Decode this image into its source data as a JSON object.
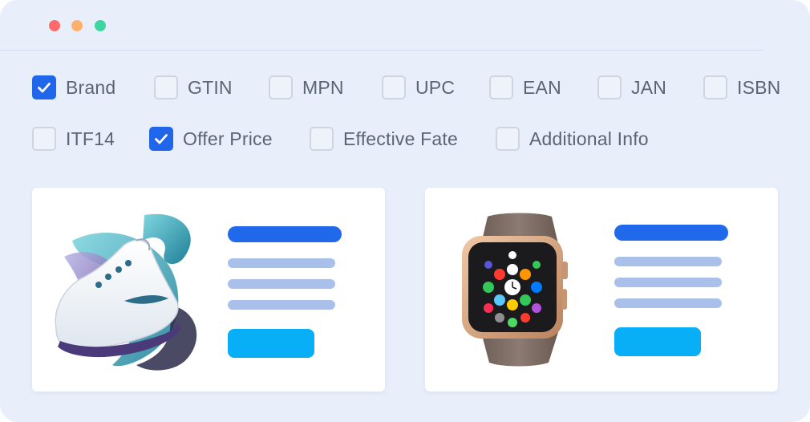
{
  "window": {
    "controls": [
      {
        "name": "close",
        "color": "#ff6b6b"
      },
      {
        "name": "minimize",
        "color": "#ffb06b"
      },
      {
        "name": "maximize",
        "color": "#3ed6a0"
      }
    ]
  },
  "filters": {
    "row1": [
      {
        "label": "Brand",
        "checked": true
      },
      {
        "label": "GTIN",
        "checked": false
      },
      {
        "label": "MPN",
        "checked": false
      },
      {
        "label": "UPC",
        "checked": false
      },
      {
        "label": "EAN",
        "checked": false
      },
      {
        "label": "JAN",
        "checked": false
      },
      {
        "label": "ISBN",
        "checked": false
      }
    ],
    "row2": [
      {
        "label": "ITF14",
        "checked": false
      },
      {
        "label": "Offer Price",
        "checked": true
      },
      {
        "label": "Effective Fate",
        "checked": false
      },
      {
        "label": "Additional Info",
        "checked": false
      }
    ]
  },
  "products": [
    {
      "image": "sneaker-image"
    },
    {
      "image": "smartwatch-image"
    }
  ],
  "colors": {
    "accent": "#1f66ea",
    "title_bar": "#2069ea",
    "text_line": "#a9c1ea",
    "button": "#08aef6",
    "background": "#e8effb",
    "label_text": "#5b6472"
  }
}
